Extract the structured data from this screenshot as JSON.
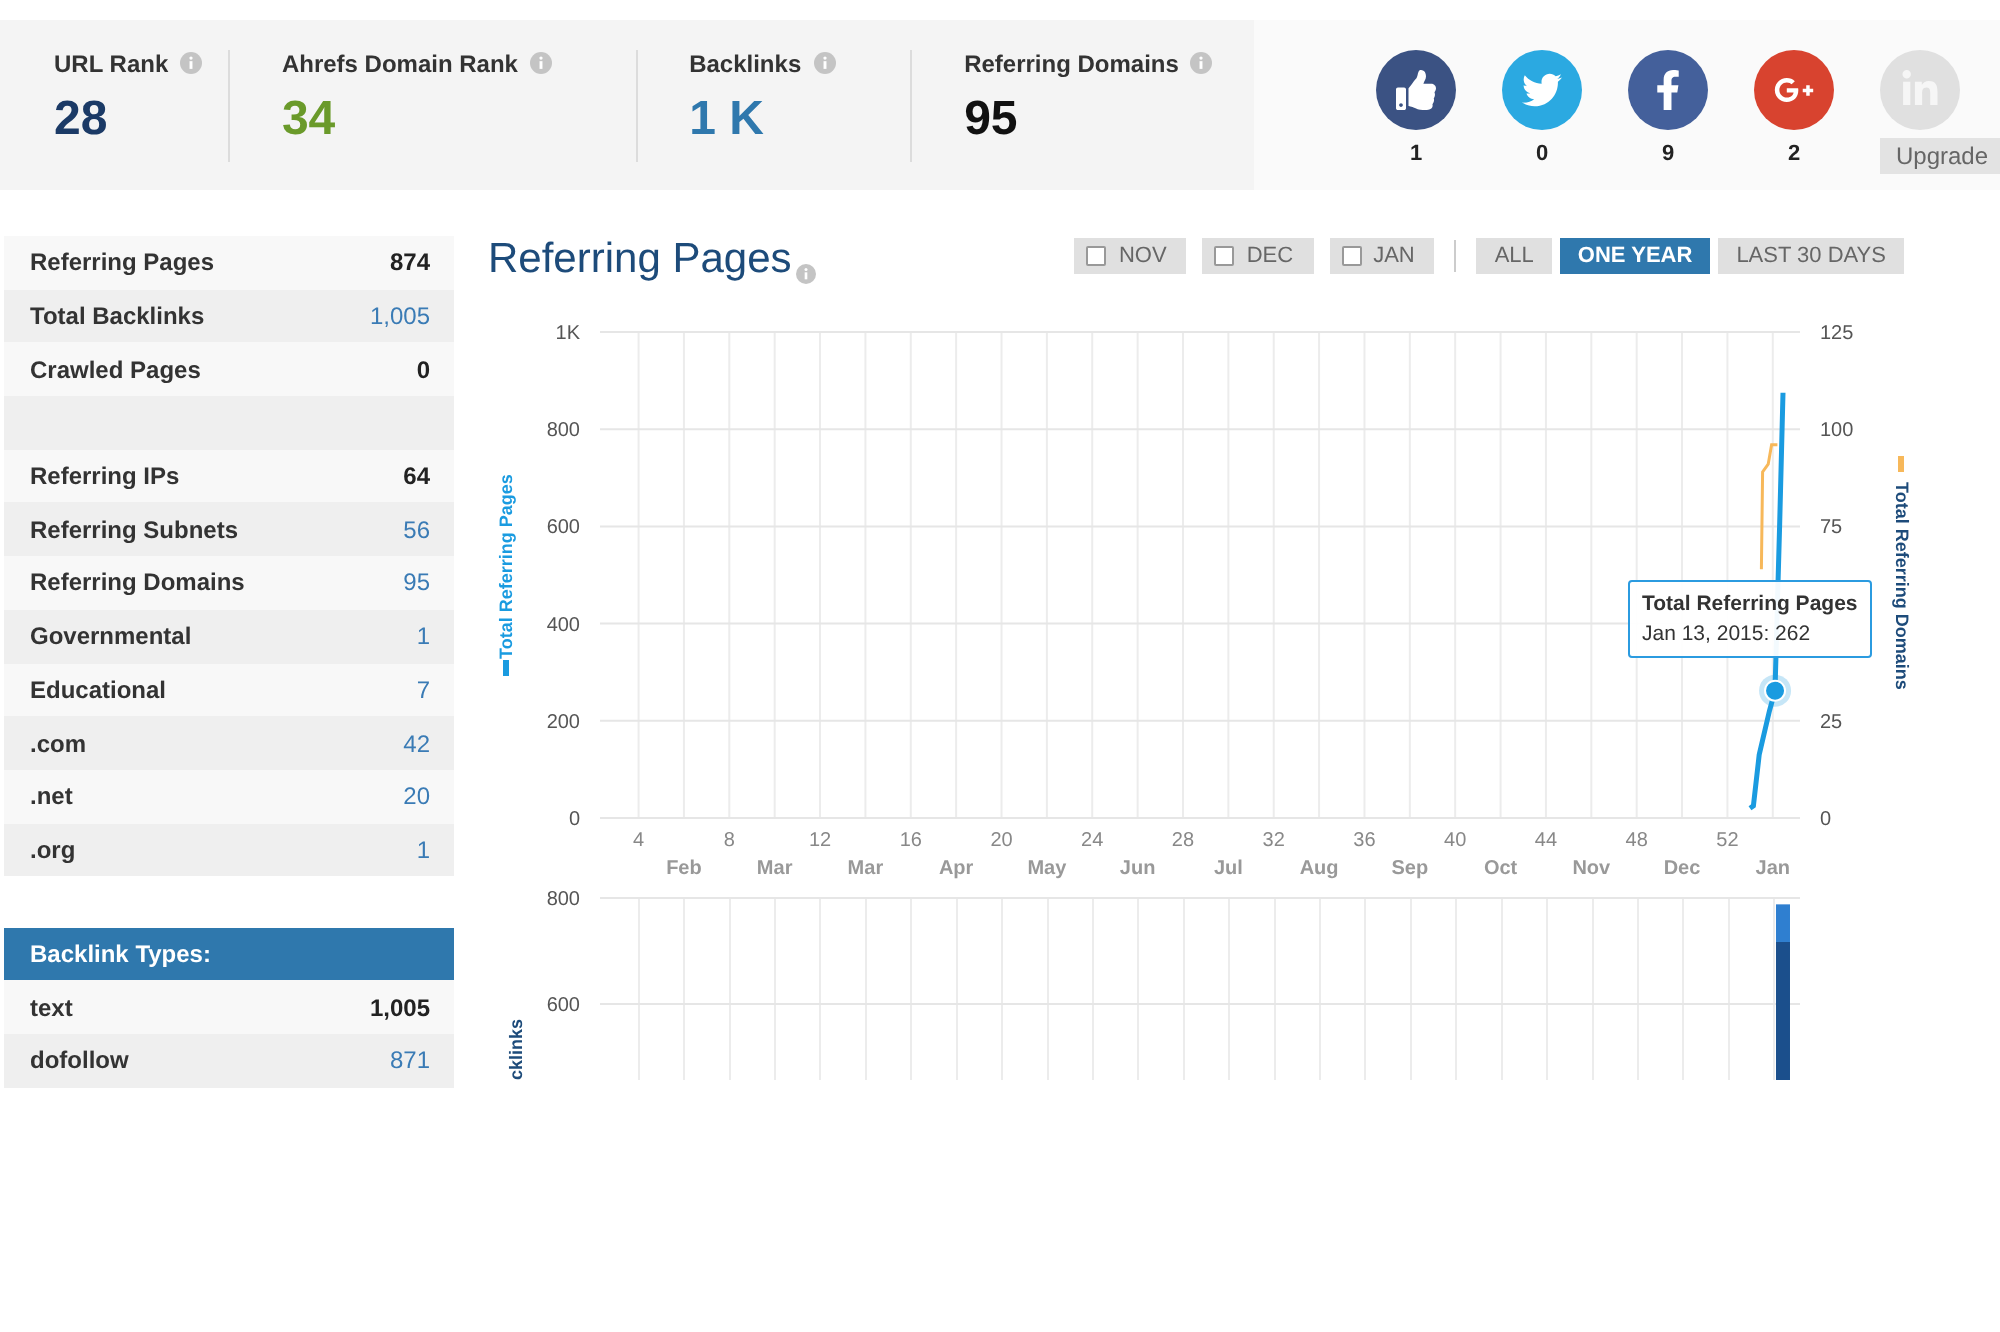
{
  "stats": [
    {
      "label": "URL Rank",
      "value": "28",
      "color": "#1b3a66"
    },
    {
      "label": "Ahrefs Domain Rank",
      "value": "34",
      "color": "#6a9a2a"
    },
    {
      "label": "Backlinks",
      "value": "1 K",
      "color": "#2f78ad"
    },
    {
      "label": "Referring Domains",
      "value": "95",
      "color": "#111111"
    }
  ],
  "social": [
    {
      "kind": "like",
      "count": "1",
      "locked": false
    },
    {
      "kind": "twitter",
      "count": "0",
      "locked": false
    },
    {
      "kind": "facebook",
      "count": "9",
      "locked": false
    },
    {
      "kind": "googleplus",
      "count": "2",
      "locked": false
    },
    {
      "kind": "linkedin",
      "locked": true,
      "button": "Upgrade"
    }
  ],
  "sidebar": {
    "rows": [
      {
        "kind": "metric",
        "label": "Referring Pages",
        "value": "874",
        "link": false
      },
      {
        "kind": "metric",
        "label": "Total Backlinks",
        "value": "1,005",
        "link": true
      },
      {
        "kind": "metric",
        "label": "Crawled Pages",
        "value": "0",
        "link": false
      },
      {
        "kind": "spacer"
      },
      {
        "kind": "metric",
        "label": "Referring IPs",
        "value": "64",
        "link": false
      },
      {
        "kind": "metric",
        "label": "Referring Subnets",
        "value": "56",
        "link": true
      },
      {
        "kind": "metric",
        "label": "Referring Domains",
        "value": "95",
        "link": true
      },
      {
        "kind": "metric",
        "label": "Governmental",
        "value": "1",
        "link": true
      },
      {
        "kind": "metric",
        "label": "Educational",
        "value": "7",
        "link": true
      },
      {
        "kind": "metric",
        "label": ".com",
        "value": "42",
        "link": true
      },
      {
        "kind": "metric",
        "label": ".net",
        "value": "20",
        "link": true
      },
      {
        "kind": "metric",
        "label": ".org",
        "value": "1",
        "link": true
      }
    ],
    "types_header": "Backlink Types:",
    "types": [
      {
        "label": "text",
        "value": "1,005",
        "link": false
      },
      {
        "label": "dofollow",
        "value": "871",
        "link": true
      }
    ]
  },
  "panel": {
    "title": "Referring Pages",
    "month_filters": [
      {
        "label": "NOV",
        "checked": false
      },
      {
        "label": "DEC",
        "checked": false
      },
      {
        "label": "JAN",
        "checked": false
      }
    ],
    "ranges": [
      {
        "label": "ALL",
        "selected": false
      },
      {
        "label": "ONE YEAR",
        "selected": true
      },
      {
        "label": "LAST 30 DAYS",
        "selected": false
      }
    ],
    "main_chart": {
      "chart_data": {
        "type": "line",
        "grid": true,
        "xlim": [
          2.3,
          55.2
        ],
        "ylim": [
          0,
          1000
        ],
        "y2lim": [
          0,
          125
        ],
        "xticks": [
          4,
          8,
          12,
          16,
          20,
          24,
          28,
          32,
          36,
          40,
          44,
          48,
          52
        ],
        "yticks": [
          0,
          200,
          400,
          600,
          800,
          {
            "value": 1000,
            "label": "1K"
          }
        ],
        "y2ticks": [
          0,
          25,
          75,
          100,
          125
        ],
        "series": [
          {
            "name": "Total Referring Pages",
            "color": "#1a9be0",
            "x": [
              53.0,
              53.15,
              53.4,
              53.85,
              54.1,
              54.3,
              54.45
            ],
            "values": [
              20,
              25,
              130,
              220,
              262,
              600,
              875
            ]
          },
          {
            "name": "Total Referring Domains",
            "color": "#f7b85a",
            "axis": "y2",
            "x": [
              53.5,
              53.55,
              53.8,
              53.95,
              54.2
            ],
            "values": [
              64,
              89,
              91,
              96,
              96
            ]
          }
        ]
      },
      "month_labels": [
        "Feb",
        "Mar",
        "Mar",
        "Apr",
        "May",
        "Jun",
        "Jul",
        "Aug",
        "Sep",
        "Oct",
        "Nov",
        "Dec",
        "Jan"
      ],
      "tooltip": {
        "title": "Total Referring Pages",
        "text": "Jan 13, 2015: 262"
      }
    },
    "backlinks_chart": {
      "chart_data": {
        "type": "bar",
        "stacked": true,
        "grid": true,
        "ylabel": "cklinks",
        "xlim": [
          2.3,
          55.2
        ],
        "ylim": [
          0,
          800
        ],
        "yticks": [
          600,
          800
        ],
        "x": [
          54.45
        ],
        "series": [
          {
            "color": "#1b4f8c",
            "values": [
              717
            ]
          },
          {
            "color": "#2f7fd0",
            "values": [
              71
            ]
          }
        ]
      }
    }
  }
}
